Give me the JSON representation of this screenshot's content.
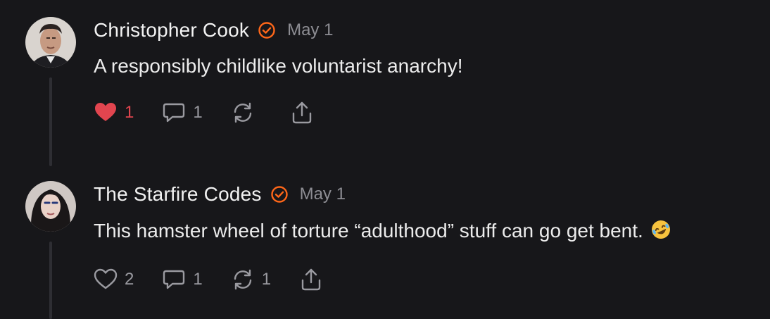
{
  "comments": [
    {
      "author": "Christopher Cook",
      "date": "May 1",
      "text": "A responsibly childlike voluntarist anarchy!",
      "likes": "1",
      "liked": true,
      "replies": "1",
      "restacks": "",
      "avatar_icon": "avatar-man-icon",
      "verified_icon": "verified-badge-icon"
    },
    {
      "author": "The Starfire Codes",
      "date": "May 1",
      "text": "This hamster wheel of torture “adulthood” stuff can go get bent.",
      "emoji": "rolling-on-floor-laughing-emoji",
      "likes": "2",
      "liked": false,
      "replies": "1",
      "restacks": "1",
      "avatar_icon": "avatar-woman-icon",
      "verified_icon": "verified-badge-icon"
    }
  ],
  "colors": {
    "background": "#17171a",
    "verified": "#ff6719",
    "liked_heart": "#e2454f",
    "muted": "#8d8d93"
  }
}
